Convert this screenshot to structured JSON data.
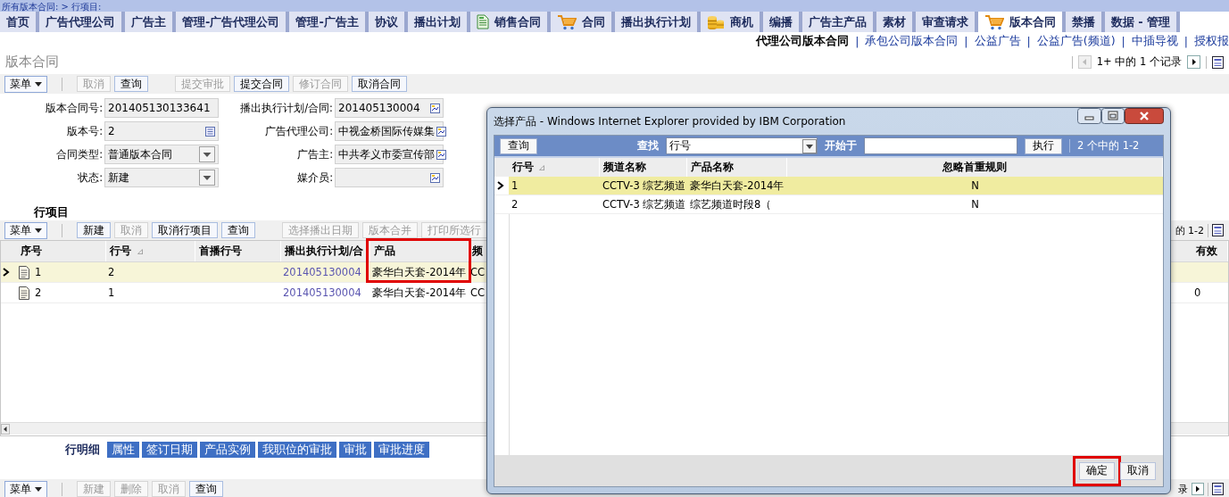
{
  "breadcrumb": "所有版本合同: > 行项目:",
  "nav_tabs": [
    {
      "label": "首页",
      "kind": "text",
      "selected": false
    },
    {
      "label": "广告代理公司",
      "kind": "text",
      "selected": false
    },
    {
      "label": "广告主",
      "kind": "text",
      "selected": false
    },
    {
      "label": "管理-广告代理公司",
      "kind": "text",
      "selected": false
    },
    {
      "label": "管理-广告主",
      "kind": "text",
      "selected": false
    },
    {
      "label": "协议",
      "kind": "text",
      "selected": false
    },
    {
      "label": "播出计划",
      "kind": "text",
      "selected": false
    },
    {
      "label": "销售合同",
      "kind": "document",
      "selected": false
    },
    {
      "label": "合同",
      "kind": "cart",
      "selected": false
    },
    {
      "label": "播出执行计划",
      "kind": "text",
      "selected": false
    },
    {
      "label": "商机",
      "kind": "coins",
      "selected": false
    },
    {
      "label": "编播",
      "kind": "text",
      "selected": false
    },
    {
      "label": "广告主产品",
      "kind": "text",
      "selected": false
    },
    {
      "label": "素材",
      "kind": "text",
      "selected": false
    },
    {
      "label": "审查请求",
      "kind": "text",
      "selected": false
    },
    {
      "label": "版本合同",
      "kind": "cart",
      "selected": true
    },
    {
      "label": "禁播",
      "kind": "text",
      "selected": false
    },
    {
      "label": "数据 - 管理",
      "kind": "text",
      "selected": false
    }
  ],
  "sub_links": [
    {
      "kind": "link",
      "label": "代理公司版本合同",
      "selected": true
    },
    {
      "kind": "separator",
      "label": "|"
    },
    {
      "kind": "link",
      "label": "承包公司版本合同",
      "selected": false
    },
    {
      "kind": "separator",
      "label": "|"
    },
    {
      "kind": "link",
      "label": "公益广告",
      "selected": false
    },
    {
      "kind": "separator",
      "label": "|"
    },
    {
      "kind": "link",
      "label": "公益广告(频道)",
      "selected": false
    },
    {
      "kind": "separator",
      "label": "|"
    },
    {
      "kind": "link",
      "label": "中插导视",
      "selected": false
    },
    {
      "kind": "separator",
      "label": "|"
    },
    {
      "kind": "link",
      "label": "授权报",
      "selected": false
    }
  ],
  "page_title": "版本合同",
  "pager": "1+ 中的 1 个记录",
  "toolbar": [
    {
      "kind": "menu",
      "label": "菜单"
    },
    {
      "kind": "separator"
    },
    {
      "kind": "button",
      "label": "取消",
      "disabled": true
    },
    {
      "kind": "button",
      "label": "查询",
      "disabled": false
    },
    {
      "kind": "spacer"
    },
    {
      "kind": "button",
      "label": "提交审批",
      "disabled": true
    },
    {
      "kind": "button",
      "label": "提交合同",
      "disabled": false
    },
    {
      "kind": "button",
      "label": "修订合同",
      "disabled": true
    },
    {
      "kind": "button",
      "label": "取消合同",
      "disabled": false
    }
  ],
  "form": [
    [
      {
        "label": "版本合同号:",
        "value": "201405130133641",
        "kind": "plain"
      },
      {
        "label": "版本号:",
        "value": "2",
        "kind": "calc"
      },
      {
        "label": "合同类型:",
        "value": "普通版本合同",
        "kind": "select"
      },
      {
        "label": "状态:",
        "value": "新建",
        "kind": "select"
      }
    ],
    [
      {
        "label": "播出执行计划/合同:",
        "value": "201405130004",
        "kind": "lookup"
      },
      {
        "label": "广告代理公司:",
        "value": "中视金桥国际传媒集",
        "kind": "lookup"
      },
      {
        "label": "广告主:",
        "value": "中共孝义市委宣传部",
        "kind": "lookup"
      },
      {
        "label": "媒介员:",
        "kind": "lookup"
      }
    ]
  ],
  "line_items": {
    "title": "行项目",
    "toolbar": [
      {
        "kind": "menu",
        "label": "菜单"
      },
      {
        "kind": "separator"
      },
      {
        "kind": "button",
        "label": "新建",
        "disabled": false
      },
      {
        "kind": "button",
        "label": "取消",
        "disabled": true
      },
      {
        "kind": "button",
        "label": "取消行项目",
        "disabled": false
      },
      {
        "kind": "button",
        "label": "查询",
        "disabled": false
      },
      {
        "kind": "spacer"
      },
      {
        "kind": "button",
        "label": "选择播出日期",
        "disabled": true
      },
      {
        "kind": "button",
        "label": "版本合并",
        "disabled": true
      },
      {
        "kind": "button",
        "label": "打印所选行",
        "disabled": true
      }
    ],
    "pager_fragment": "的 1-2",
    "columns": [
      {
        "label": "序号",
        "highlighted": false
      },
      {
        "label": "行号",
        "sort_mark": "⊿",
        "highlighted": false
      },
      {
        "label": "首播行号",
        "highlighted": false
      },
      {
        "label": "播出执行计划/合",
        "highlighted": false
      },
      {
        "label": "产品",
        "highlighted": true
      },
      {
        "label": "频",
        "highlighted": false
      },
      {
        "label": "有效",
        "highlighted": false
      }
    ],
    "rows": [
      {
        "selected": true,
        "seq": "1",
        "line_no": "2",
        "plan": "201405130004",
        "product": "豪华白天套-2014年",
        "channel": "CC"
      },
      {
        "selected": false,
        "seq": "2",
        "line_no": "1",
        "plan": "201405130004",
        "product": "豪华白天套-2014年",
        "channel": "CC",
        "column_7": "0"
      }
    ]
  },
  "detail_tabs": [
    {
      "label": "行明细",
      "selected": true
    },
    {
      "label": "属性",
      "selected": false
    },
    {
      "label": "签订日期",
      "selected": false
    },
    {
      "label": "产品实例",
      "selected": false
    },
    {
      "label": "我职位的审批",
      "selected": false
    },
    {
      "label": "审批",
      "selected": false
    },
    {
      "label": "审批进度",
      "selected": false
    }
  ],
  "detail_toolbar": [
    {
      "kind": "menu",
      "label": "菜单"
    },
    {
      "kind": "separator"
    },
    {
      "kind": "button",
      "label": "新建",
      "disabled": true
    },
    {
      "kind": "button",
      "label": "删除",
      "disabled": true
    },
    {
      "kind": "button",
      "label": "取消",
      "disabled": true
    },
    {
      "kind": "button",
      "label": "查询",
      "disabled": false
    }
  ],
  "detail_pager_fragment": "录",
  "dialog": {
    "title": "选择产品 - Windows Internet Explorer provided by IBM Corporation",
    "search": {
      "query_button": "查询",
      "find_label": "查找",
      "find_value": "行号",
      "start_label": "开始于",
      "run_button": "执行",
      "count": "2 个中的 1-2"
    },
    "columns": [
      {
        "label": "行号",
        "sort_mark": "⊿"
      },
      {
        "label": "频道名称"
      },
      {
        "label": "产品名称"
      },
      {
        "label": "忽略首重规则"
      }
    ],
    "rows": [
      {
        "selected": true,
        "line_no": "1",
        "channel": "CCTV-3 综艺频道",
        "product": "豪华白天套-2014年",
        "ignore_rule": "N"
      },
      {
        "selected": false,
        "line_no": "2",
        "channel": "CCTV-3 综艺频道",
        "product": "综艺频道时段8（",
        "ignore_rule": "N"
      }
    ],
    "buttons": [
      {
        "label": "确定",
        "highlighted": true
      },
      {
        "label": "取消",
        "highlighted": false
      }
    ]
  }
}
